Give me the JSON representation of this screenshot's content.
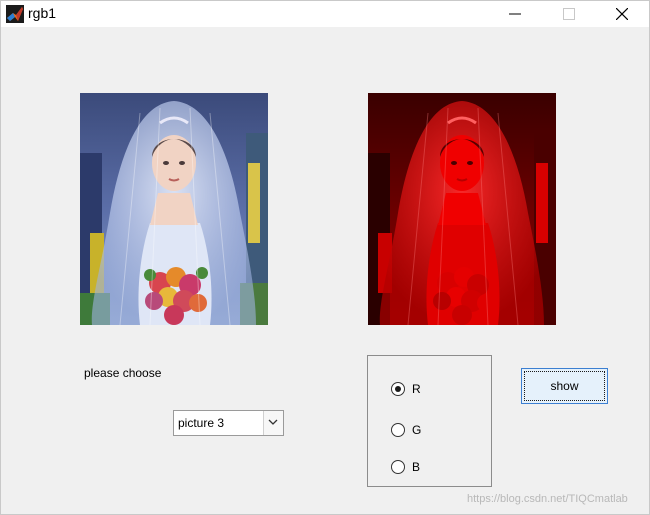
{
  "window": {
    "title": "rgb1",
    "app_icon": "matlab-icon"
  },
  "controls": {
    "minimize": "minimize-icon",
    "maximize": "maximize-icon",
    "close": "close-icon"
  },
  "images": {
    "left": "original-photo",
    "right": "red-channel-photo"
  },
  "main": {
    "choose_label": "please choose",
    "dropdown": {
      "selected": "picture 3"
    },
    "radio_group": {
      "options": [
        {
          "label": "R",
          "checked": true
        },
        {
          "label": "G",
          "checked": false
        },
        {
          "label": "B",
          "checked": false
        }
      ]
    },
    "show_button": "show"
  },
  "watermark": "https://blog.csdn.net/TIQCmatlab",
  "colors": {
    "background": "#f0f0f0",
    "button_fill": "#e5f1fb",
    "button_border": "#3c7fd1",
    "red_channel": "#ff0000"
  }
}
